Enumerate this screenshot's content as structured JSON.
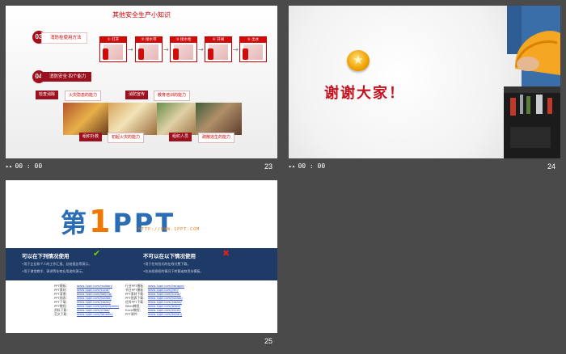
{
  "slides": [
    {
      "number": "23",
      "time": "00 : 00",
      "title": "其他安全生产小知识",
      "sections": [
        {
          "badge": "03",
          "label": "消防栓使用方法"
        },
        {
          "badge": "04",
          "label": "消防安全 四个能力"
        }
      ],
      "steps": [
        "① 打开",
        "② 接水带",
        "③ 接水枪",
        "④ 开阀",
        "⑤ 出水"
      ],
      "capabilities": [
        {
          "title": "检查消除",
          "desc": "火灾隐患的能力"
        },
        {
          "title": "消防宣传",
          "desc": "教育培训的能力"
        },
        {
          "title": "组织扑救",
          "desc": "初起火灾的能力"
        },
        {
          "title": "组织人员",
          "desc": "疏散逃生的能力"
        }
      ]
    },
    {
      "number": "24",
      "time": "00 : 00",
      "thanks": "谢谢大家！"
    },
    {
      "number": "25",
      "logo_main": "第",
      "logo_one": "1",
      "logo_ppt": "PPT",
      "logo_url": "HTTP://WWW.1PPT.COM",
      "can_use": {
        "title": "可以在下列情况使用",
        "lines": [
          "•用于企业和个人的工作汇报、总结报告等演示。",
          "•用于课堂教学、演讲等非商业用途的演示。"
        ]
      },
      "cannot_use": {
        "title": "不可以在以下情况使用",
        "lines": [
          "•用于任何形式的在线付费下载。",
          "•在未经授权的情况下转载或商用本模板。"
        ]
      },
      "links_left": [
        {
          "label": "PPT模板：",
          "url": "www.1ppt.com/moban/"
        },
        {
          "label": "PPT素材：",
          "url": "www.1ppt.com/sucai/"
        },
        {
          "label": "PPT背景：",
          "url": "www.1ppt.com/beijing/"
        },
        {
          "label": "PPT图表：",
          "url": "www.1ppt.com/tubiao/"
        },
        {
          "label": "PPT下载：",
          "url": "www.1ppt.com/xiazai/"
        },
        {
          "label": "PPT教程：",
          "url": "www.1ppt.com/powerpoint/"
        },
        {
          "label": "资料下载：",
          "url": "www.1ppt.com/ziliao/"
        },
        {
          "label": "范文下载：",
          "url": "www.1ppt.com/fanwen/"
        }
      ],
      "links_right": [
        {
          "label": "行业PPT模板：",
          "url": "www.1ppt.com/hangye/"
        },
        {
          "label": "节日PPT模板：",
          "url": "www.1ppt.com/jieri/"
        },
        {
          "label": "PPT素材下载：",
          "url": "www.1ppt.com/sucai/"
        },
        {
          "label": "PPT图表下载：",
          "url": "www.1ppt.com/tubiao/"
        },
        {
          "label": "优秀PPT下载：",
          "url": "www.1ppt.com/xiazai/"
        },
        {
          "label": "Word教程：",
          "url": "www.1ppt.com/word/"
        },
        {
          "label": "Excel教程：",
          "url": "www.1ppt.com/excel/"
        },
        {
          "label": "PPT课件：",
          "url": "www.1ppt.com/kejian/"
        }
      ]
    }
  ]
}
